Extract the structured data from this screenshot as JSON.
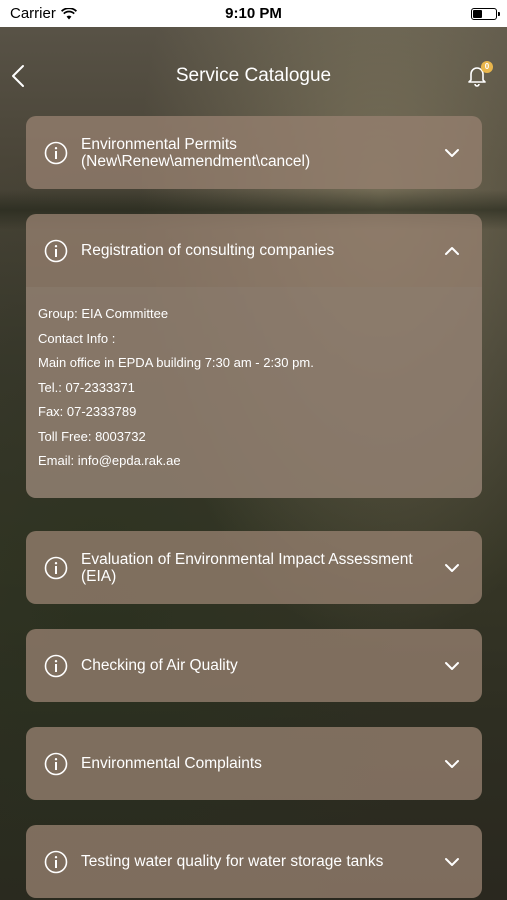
{
  "status_bar": {
    "carrier": "Carrier",
    "time": "9:10 PM"
  },
  "nav": {
    "title": "Service Catalogue",
    "back_icon": "chevron-left-icon",
    "notification_icon": "bell-icon",
    "badge": "0"
  },
  "colors": {
    "card_background": "#96806f",
    "badge": "#e9b64c",
    "text": "#ffffff"
  },
  "services": [
    {
      "title": "Environmental Permits (New\\Renew\\amendment\\cancel)",
      "expanded": false
    },
    {
      "title": "Registration of consulting companies",
      "expanded": true,
      "details": [
        "Group: EIA Committee",
        "Contact Info :",
        "Main office in EPDA building 7:30 am - 2:30 pm.",
        "Tel.: 07-2333371",
        "Fax: 07-2333789",
        "Toll Free: 8003732",
        "Email: info@epda.rak.ae"
      ]
    },
    {
      "title": "Evaluation of Environmental Impact Assessment (EIA)",
      "expanded": false
    },
    {
      "title": "Checking of Air Quality",
      "expanded": false
    },
    {
      "title": "Environmental Complaints",
      "expanded": false
    },
    {
      "title": "Testing water quality for water storage tanks",
      "expanded": false
    }
  ]
}
